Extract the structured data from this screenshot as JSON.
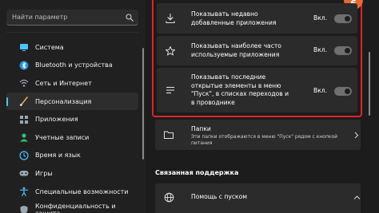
{
  "sidebar": {
    "search": {
      "placeholder": "Найти параметр",
      "value": ""
    },
    "items": [
      {
        "label": "Система",
        "icon": "system-icon",
        "color": "#4cc2ff"
      },
      {
        "label": "Bluetooth и устройства",
        "icon": "bluetooth-icon",
        "color": "#4cc2ff"
      },
      {
        "label": "Сеть и Интернет",
        "icon": "network-icon",
        "color": "#9aa7b3"
      },
      {
        "label": "Персонализация",
        "icon": "brush-icon",
        "color": "#f0a55b",
        "active": true
      },
      {
        "label": "Приложения",
        "icon": "apps-icon",
        "color": "#9aa7b3"
      },
      {
        "label": "Учетные записи",
        "icon": "accounts-icon",
        "color": "#2fbf71"
      },
      {
        "label": "Время и язык",
        "icon": "time-language-icon",
        "color": "#4cc2ff"
      },
      {
        "label": "Игры",
        "icon": "gaming-icon",
        "color": "#9aa7b3"
      },
      {
        "label": "Специальные возможности",
        "icon": "accessibility-icon",
        "color": "#4cc2ff"
      },
      {
        "label": "Конфиденциальность и защита",
        "icon": "shield-icon",
        "color": "#9aa7b3"
      }
    ]
  },
  "main": {
    "badge": "6",
    "toggle_label": "Вкл.",
    "settings": [
      {
        "lines": [
          "Показывать недавно",
          "добавленные приложения"
        ],
        "icon": "download-icon",
        "on": true
      },
      {
        "lines": [
          "Показывать наиболее часто",
          "используемые приложения"
        ],
        "icon": "star-icon",
        "on": true
      },
      {
        "lines": [
          "Показывать последние",
          "открытые элементы в меню",
          "\"Пуск\", в списках переходов и",
          "в проводнике"
        ],
        "icon": "list-icon",
        "on": true
      }
    ],
    "folders": {
      "title": "Папки",
      "description_lines": [
        "Эти папки отображаются в меню \"Пуск\" рядом с кнопкой",
        "питания"
      ]
    },
    "support": {
      "section_title": "Связанная поддержка",
      "help_label": "Помощь с пуском"
    }
  },
  "colors": {
    "accent": "#4cc2ff",
    "highlight_border": "#e2222a",
    "badge": "#e26a35"
  }
}
